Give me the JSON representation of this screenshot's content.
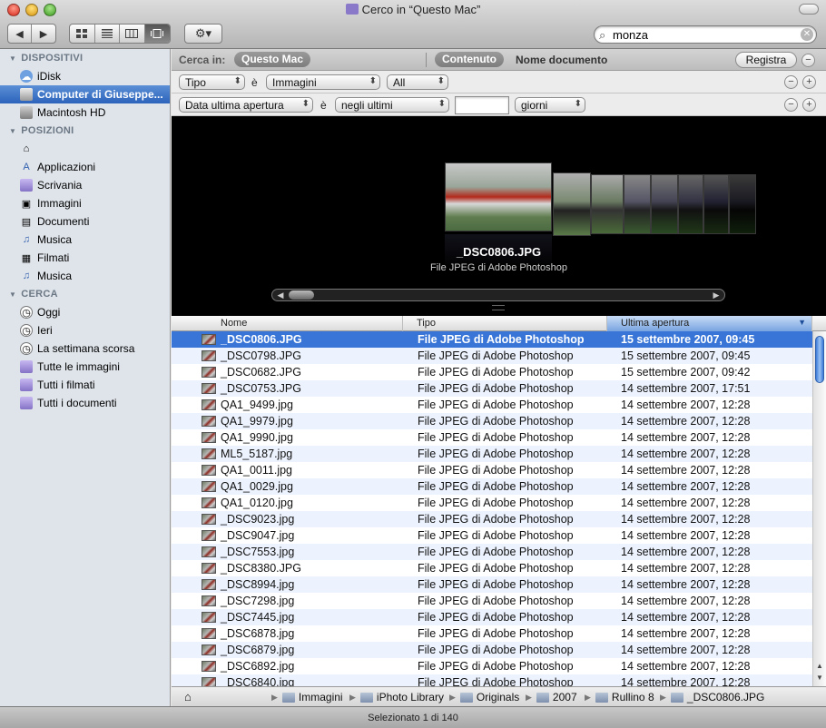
{
  "window": {
    "title": "Cerco in “Questo Mac”"
  },
  "toolbar": {
    "back_glyph": "◀",
    "forward_glyph": "▶",
    "views": [
      "icon-view",
      "list-view",
      "column-view",
      "coverflow-view"
    ],
    "active_view": 3,
    "action_glyph": "⚙▾",
    "search_value": "monza",
    "search_glyph": "⌕",
    "clear_glyph": "✕"
  },
  "sidebar": {
    "sections": [
      {
        "label": "DISPOSITIVI",
        "items": [
          {
            "label": "iDisk",
            "icon": "idisk-icon"
          },
          {
            "label": "Computer di Giuseppe...",
            "icon": "computer-icon",
            "selected": true
          },
          {
            "label": "Macintosh HD",
            "icon": "hard-drive-icon"
          }
        ]
      },
      {
        "label": "POSIZIONI",
        "items": [
          {
            "label": "",
            "icon": "home-icon"
          },
          {
            "label": "Applicazioni",
            "icon": "applications-icon"
          },
          {
            "label": "Scrivania",
            "icon": "desktop-icon"
          },
          {
            "label": "Immagini",
            "icon": "pictures-icon"
          },
          {
            "label": "Documenti",
            "icon": "documents-icon"
          },
          {
            "label": "Musica",
            "icon": "music-icon"
          },
          {
            "label": "Filmati",
            "icon": "movies-icon"
          },
          {
            "label": "Musica",
            "icon": "music-icon"
          }
        ]
      },
      {
        "label": "CERCA",
        "items": [
          {
            "label": "Oggi",
            "icon": "clock-icon"
          },
          {
            "label": "Ieri",
            "icon": "clock-icon"
          },
          {
            "label": "La settimana scorsa",
            "icon": "clock-icon"
          },
          {
            "label": "Tutte le immagini",
            "icon": "smart-folder-icon"
          },
          {
            "label": "Tutti i filmati",
            "icon": "smart-folder-icon"
          },
          {
            "label": "Tutti i documenti",
            "icon": "smart-folder-icon"
          }
        ]
      }
    ]
  },
  "criteria": {
    "search_in_label": "Cerca in:",
    "scope_this_mac": "Questo Mac",
    "content_pill": "Contenuto",
    "filename_option": "Nome documento",
    "save_label": "Registra",
    "row1": {
      "attr": "Tipo",
      "op": "è",
      "value": "Immagini",
      "sub": "All"
    },
    "row2": {
      "attr": "Data ultima apertura",
      "op": "è",
      "value": "negli ultimi",
      "number": "",
      "unit": "giorni"
    },
    "minus_glyph": "−",
    "plus_glyph": "+"
  },
  "coverflow": {
    "selected_name": "_DSC0806.JPG",
    "selected_kind": "File JPEG di Adobe Photoshop"
  },
  "list": {
    "columns": [
      "Nome",
      "Tipo",
      "Ultima apertura"
    ],
    "sort_glyph": "▼",
    "rows": [
      {
        "name": "_DSC0806.JPG",
        "kind": "File JPEG di Adobe Photoshop",
        "date": "15 settembre 2007, 09:45",
        "selected": true
      },
      {
        "name": "_DSC0798.JPG",
        "kind": "File JPEG di Adobe Photoshop",
        "date": "15 settembre 2007, 09:45"
      },
      {
        "name": "_DSC0682.JPG",
        "kind": "File JPEG di Adobe Photoshop",
        "date": "15 settembre 2007, 09:42"
      },
      {
        "name": "_DSC0753.JPG",
        "kind": "File JPEG di Adobe Photoshop",
        "date": "14 settembre 2007, 17:51"
      },
      {
        "name": "QA1_9499.jpg",
        "kind": "File JPEG di Adobe Photoshop",
        "date": "14 settembre 2007, 12:28"
      },
      {
        "name": "QA1_9979.jpg",
        "kind": "File JPEG di Adobe Photoshop",
        "date": "14 settembre 2007, 12:28"
      },
      {
        "name": "QA1_9990.jpg",
        "kind": "File JPEG di Adobe Photoshop",
        "date": "14 settembre 2007, 12:28"
      },
      {
        "name": "ML5_5187.jpg",
        "kind": "File JPEG di Adobe Photoshop",
        "date": "14 settembre 2007, 12:28"
      },
      {
        "name": "QA1_0011.jpg",
        "kind": "File JPEG di Adobe Photoshop",
        "date": "14 settembre 2007, 12:28"
      },
      {
        "name": "QA1_0029.jpg",
        "kind": "File JPEG di Adobe Photoshop",
        "date": "14 settembre 2007, 12:28"
      },
      {
        "name": "QA1_0120.jpg",
        "kind": "File JPEG di Adobe Photoshop",
        "date": "14 settembre 2007, 12:28"
      },
      {
        "name": "_DSC9023.jpg",
        "kind": "File JPEG di Adobe Photoshop",
        "date": "14 settembre 2007, 12:28"
      },
      {
        "name": "_DSC9047.jpg",
        "kind": "File JPEG di Adobe Photoshop",
        "date": "14 settembre 2007, 12:28"
      },
      {
        "name": "_DSC7553.jpg",
        "kind": "File JPEG di Adobe Photoshop",
        "date": "14 settembre 2007, 12:28"
      },
      {
        "name": "_DSC8380.JPG",
        "kind": "File JPEG di Adobe Photoshop",
        "date": "14 settembre 2007, 12:28"
      },
      {
        "name": "_DSC8994.jpg",
        "kind": "File JPEG di Adobe Photoshop",
        "date": "14 settembre 2007, 12:28"
      },
      {
        "name": "_DSC7298.jpg",
        "kind": "File JPEG di Adobe Photoshop",
        "date": "14 settembre 2007, 12:28"
      },
      {
        "name": "_DSC7445.jpg",
        "kind": "File JPEG di Adobe Photoshop",
        "date": "14 settembre 2007, 12:28"
      },
      {
        "name": "_DSC6878.jpg",
        "kind": "File JPEG di Adobe Photoshop",
        "date": "14 settembre 2007, 12:28"
      },
      {
        "name": "_DSC6879.jpg",
        "kind": "File JPEG di Adobe Photoshop",
        "date": "14 settembre 2007, 12:28"
      },
      {
        "name": "_DSC6892.jpg",
        "kind": "File JPEG di Adobe Photoshop",
        "date": "14 settembre 2007, 12:28"
      },
      {
        "name": "_DSC6840.jpg",
        "kind": "File JPEG di Adobe Photoshop",
        "date": "14 settembre 2007, 12:28"
      }
    ]
  },
  "pathbar": {
    "home_glyph": "⌂",
    "items": [
      "Immagini",
      "iPhoto Library",
      "Originals",
      "2007",
      "Rullino 8",
      "_DSC0806.JPG"
    ]
  },
  "status": {
    "text": "Selezionato 1 di 140"
  }
}
